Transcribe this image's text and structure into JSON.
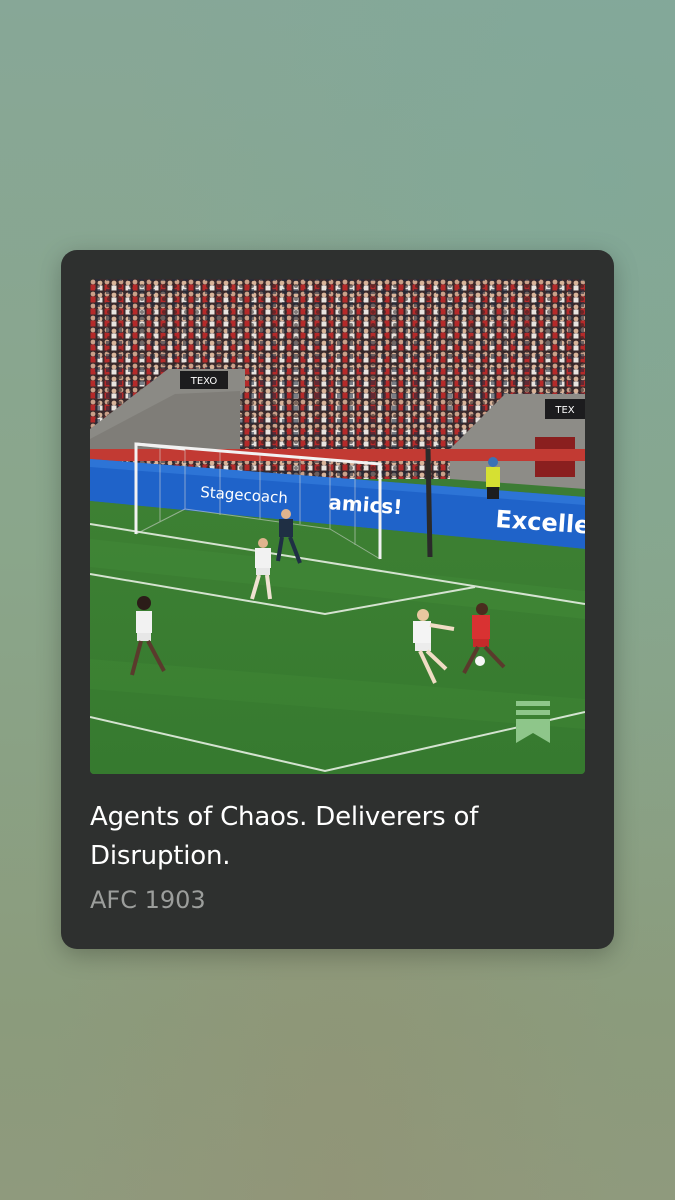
{
  "card": {
    "title": "Agents of Chaos. Deliverers of Disruption.",
    "subtitle": "AFC 1903"
  },
  "media": {
    "description_icon": "football-match-photo",
    "boards": {
      "sponsor_left": "Stagecoach",
      "sponsor_mid": "amics!",
      "sponsor_right": "Excelle",
      "stand_sign_left": "TEXO",
      "stand_sign_right": "TEX"
    },
    "bookmark_icon": "bookmark-icon"
  },
  "colors": {
    "card_bg": "#2e302f",
    "title": "#ffffff",
    "subtitle": "#9c9e9c",
    "bookmark": "#8ec68a"
  }
}
